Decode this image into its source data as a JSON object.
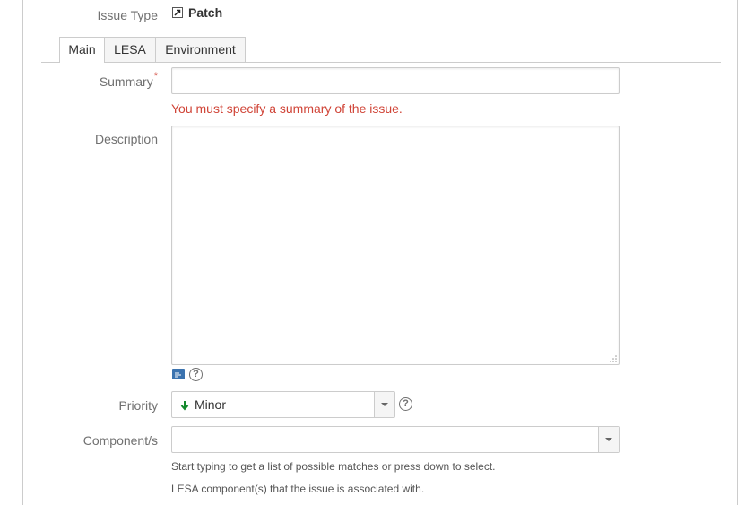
{
  "form": {
    "issue_type": {
      "label": "Issue Type",
      "value": "Patch",
      "icon": "patch-icon"
    },
    "tabs": [
      {
        "label": "Main",
        "active": true
      },
      {
        "label": "LESA",
        "active": false
      },
      {
        "label": "Environment",
        "active": false
      }
    ],
    "summary": {
      "label": "Summary",
      "required_marker": "*",
      "value": "",
      "error": "You must specify a summary of the issue."
    },
    "description": {
      "label": "Description",
      "value": ""
    },
    "priority": {
      "label": "Priority",
      "value": "Minor",
      "icon": "arrow-down-green-icon"
    },
    "components": {
      "label": "Component/s",
      "value": "",
      "hint1": "Start typing to get a list of possible matches or press down to select.",
      "hint2": "LESA component(s) that the issue is associated with."
    }
  },
  "colors": {
    "error": "#d04437",
    "label": "#707070",
    "wiki_icon": "#3b73af",
    "priority_arrow": "#14892c"
  }
}
